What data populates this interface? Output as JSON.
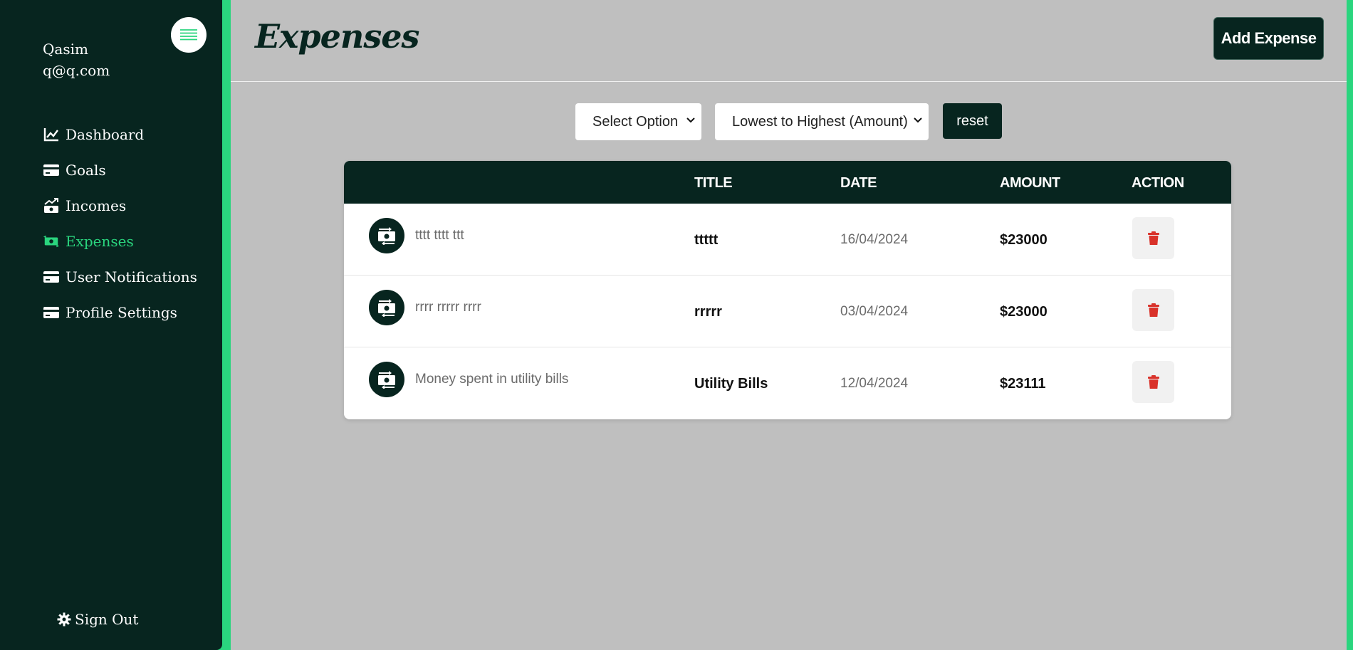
{
  "user": {
    "name": "Qasim",
    "email": "q@q.com"
  },
  "sidebar": {
    "items": [
      {
        "label": "Dashboard",
        "icon": "chart-line-icon"
      },
      {
        "label": "Goals",
        "icon": "credit-card-icon"
      },
      {
        "label": "Incomes",
        "icon": "money-trend-icon"
      },
      {
        "label": "Expenses",
        "icon": "money-bill-icon",
        "active": true
      },
      {
        "label": "User Notifications",
        "icon": "credit-card-icon"
      },
      {
        "label": "Profile Settings",
        "icon": "credit-card-icon"
      }
    ],
    "signout_label": "Sign Out"
  },
  "header": {
    "title": "Expenses",
    "add_button": "Add Expense"
  },
  "filters": {
    "category_selected": "Select Option",
    "sort_selected": "Lowest to Highest (Amount)",
    "reset_label": "reset"
  },
  "table": {
    "columns": [
      "TITLE",
      "DATE",
      "AMOUNT",
      "ACTION"
    ],
    "rows": [
      {
        "description": "tttt tttt ttt",
        "title": "ttttt",
        "date": "16/04/2024",
        "amount": "$23000"
      },
      {
        "description": "rrrr rrrrr rrrr",
        "title": "rrrrr",
        "date": "03/04/2024",
        "amount": "$23000"
      },
      {
        "description": "Money spent in utility bills",
        "title": "Utility Bills",
        "date": "12/04/2024",
        "amount": "$23111"
      }
    ]
  },
  "colors": {
    "sidebar_bg": "#07251f",
    "accent": "#2ad57e",
    "main_bg": "#bfbfbf",
    "delete": "#d9322a"
  }
}
